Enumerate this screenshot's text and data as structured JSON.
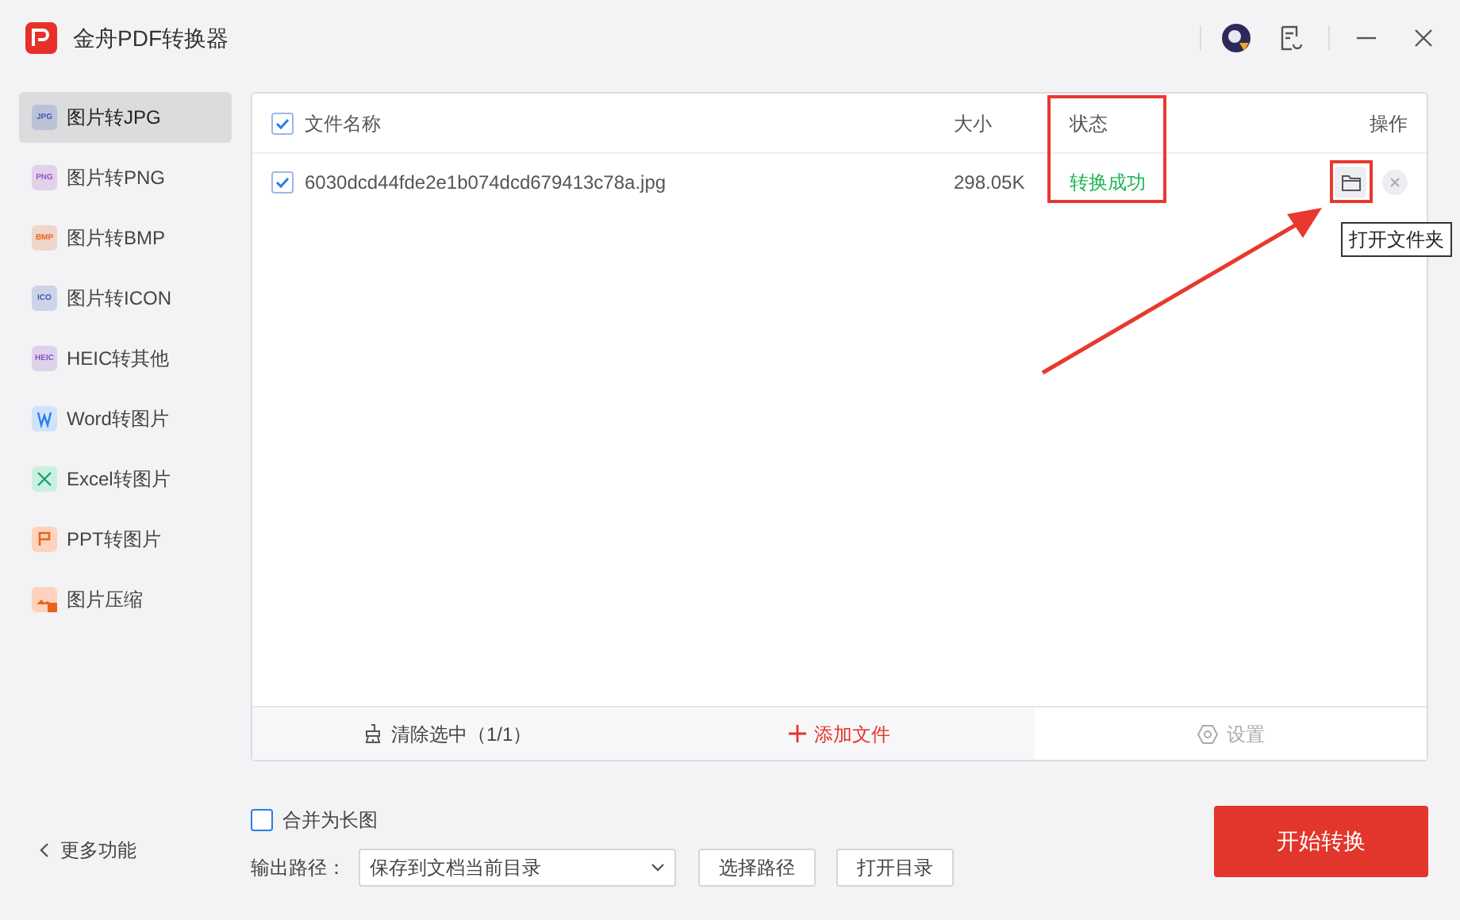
{
  "window": {
    "title": "金舟PDF转换器"
  },
  "sidebar": {
    "items": [
      {
        "label": "图片转JPG",
        "icon_text": "JPG",
        "color": "#3b5bb5",
        "selected": true
      },
      {
        "label": "图片转PNG",
        "icon_text": "PNG",
        "color": "#9b4fc8",
        "selected": false
      },
      {
        "label": "图片转BMP",
        "icon_text": "BMP",
        "color": "#e8641c",
        "selected": false
      },
      {
        "label": "图片转ICON",
        "icon_text": "ICO",
        "color": "#3b5bb5",
        "selected": false
      },
      {
        "label": "HEIC转其他",
        "icon_text": "HEIC",
        "color": "#8a4fc0",
        "selected": false
      },
      {
        "label": "Word转图片",
        "kind": "word",
        "color": "#2b7de9",
        "selected": false
      },
      {
        "label": "Excel转图片",
        "kind": "excel",
        "color": "#1aa36b",
        "selected": false
      },
      {
        "label": "PPT转图片",
        "kind": "ppt",
        "color": "#e8641c",
        "selected": false
      },
      {
        "label": "图片压缩",
        "kind": "compress",
        "color": "#e8641c",
        "selected": false
      }
    ],
    "more": "更多功能"
  },
  "table": {
    "select_all": true,
    "columns": [
      "文件名称",
      "大小",
      "状态",
      "操作"
    ],
    "rows": [
      {
        "checked": true,
        "name": "6030dcd44fde2e1b074dcd679413c78a.jpg",
        "size": "298.05K",
        "status": "转换成功"
      }
    ],
    "tooltip": "打开文件夹"
  },
  "toolbar": {
    "clear": "清除选中（1/1）",
    "add": "添加文件",
    "settings": "设置",
    "settings_disabled": true
  },
  "options": {
    "merge_label": "合并为长图",
    "merge_checked": false,
    "output_label": "输出路径：",
    "output_value": "保存到文档当前目录",
    "choose": "选择路径",
    "open": "打开目录"
  },
  "start": "开始转换"
}
